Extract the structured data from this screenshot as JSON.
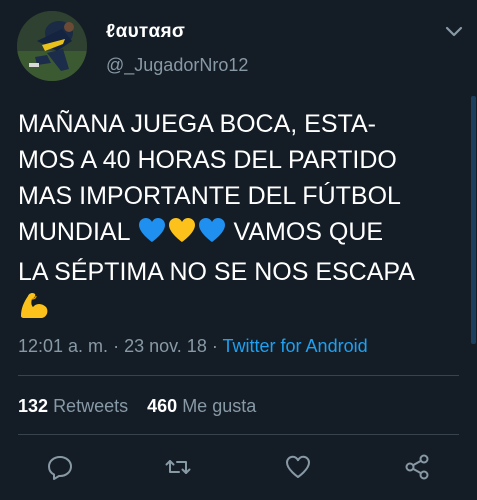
{
  "user": {
    "display_name": "ℓαυтαяσ",
    "handle": "@_JugadorNro12"
  },
  "tweet": {
    "lines": [
      "MAÑANA JUEGA BOCA, ESTA-",
      "MOS A 40 HORAS DEL PARTIDO",
      "MAS IMPORTANTE DEL FÚTBOL",
      "MUNDIAL",
      "VAMOS QUE",
      "LA SÉPTIMA NO SE NOS ESCAPA"
    ],
    "emojis": [
      "blue-heart",
      "yellow-heart",
      "blue-heart",
      "flexed-biceps"
    ]
  },
  "meta": {
    "time": "12:01 a. m.",
    "separator": "·",
    "date": "23 nov. 18",
    "source": "Twitter for Android"
  },
  "stats": {
    "retweets_count": "132",
    "retweets_label": "Retweets",
    "likes_count": "460",
    "likes_label": "Me gusta"
  },
  "icons": {
    "caret": "chevron-down-icon",
    "reply": "reply-icon",
    "retweet": "retweet-icon",
    "like": "heart-icon",
    "share": "share-icon"
  },
  "colors": {
    "background": "#141d26",
    "secondary_text": "#8899a6",
    "link": "#1da1f2",
    "divider": "#38444d"
  }
}
